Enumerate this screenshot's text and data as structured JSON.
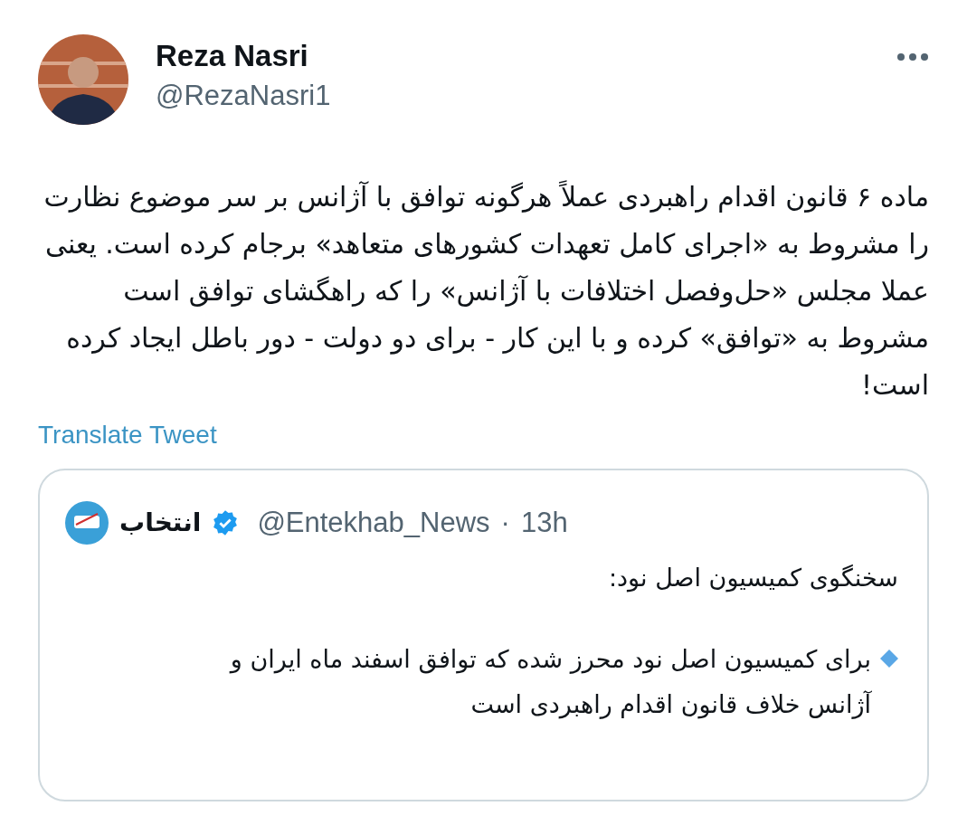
{
  "author": {
    "name": "Reza Nasri",
    "handle": "@RezaNasri1"
  },
  "text": "ماده ۶ قانون اقدام راهبردی عملاً هرگونه توافق با آژانس بر سر موضوع نظارت را مشروط به «اجرای کامل تعهدات کشورهای متعاهد» برجام کرده است. یعنی عملا مجلس «حل‌وفصل اختلافات با آژانس» را که راهگشای توافق است مشروط به «توافق» کرده و با این کار - برای دو دولت - دور باطل ایجاد کرده است!",
  "translate_link": "Translate Tweet",
  "quoted": {
    "name": "انتخاب",
    "verified": true,
    "handle": "@Entekhab_News",
    "separator": "·",
    "time": "13h",
    "paragraphs": [
      {
        "kind": "plain",
        "text": "سخنگوی کمیسیون اصل نود:"
      },
      {
        "kind": "bullet",
        "text": "برای کمیسیون اصل نود محرز شده که توافق اسفند ماه ایران و آژانس خلاف قانون اقدام راهبردی است"
      }
    ]
  }
}
